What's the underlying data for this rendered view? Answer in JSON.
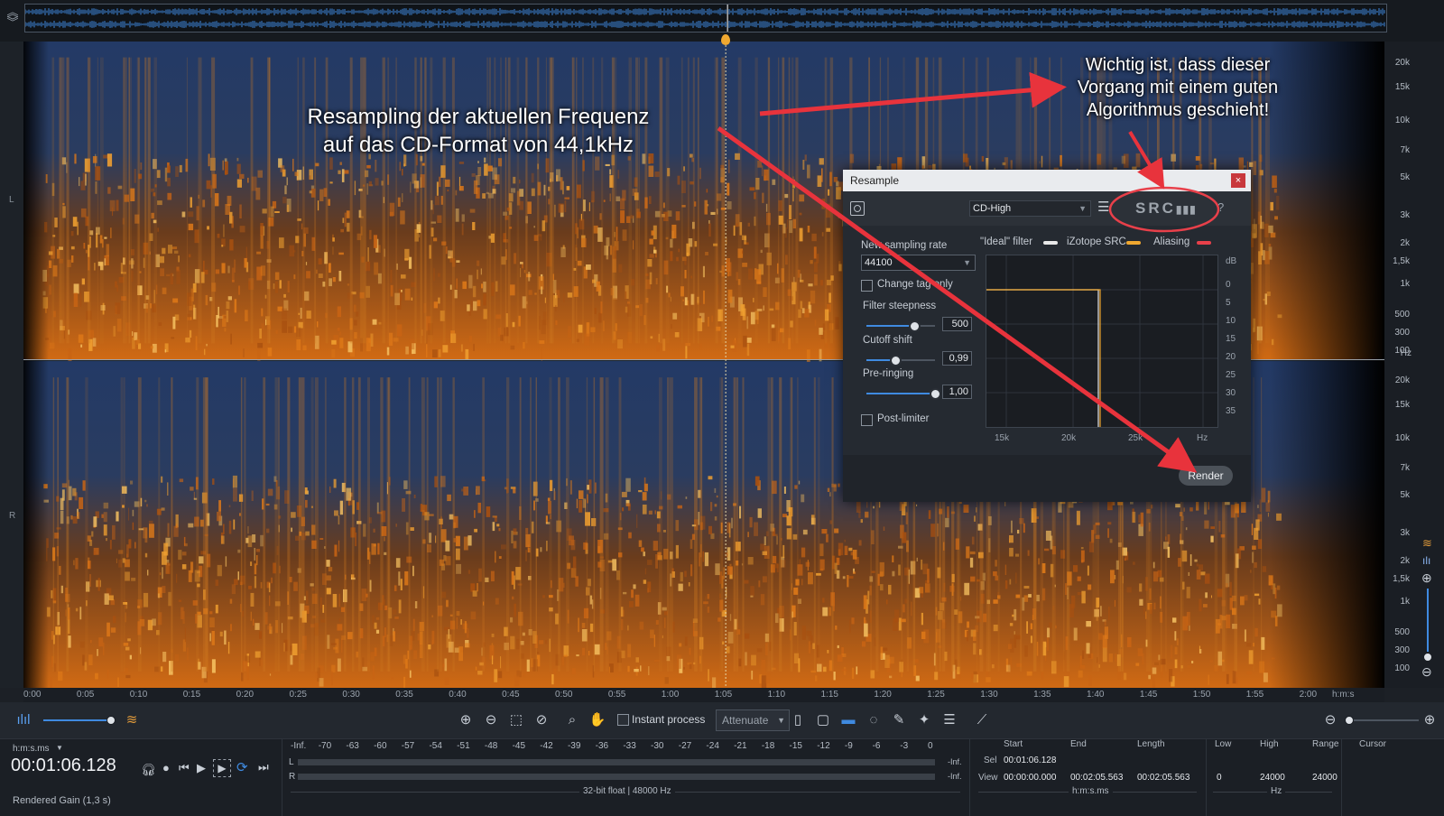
{
  "annotations": {
    "main_line1": "Resampling der aktuellen Frequenz",
    "main_line2": "auf das CD-Format von 44,1kHz",
    "note_line1": "Wichtig ist, dass dieser",
    "note_line2": "Vorgang mit einem guten",
    "note_line3": "Algorithmus geschieht!"
  },
  "channels": {
    "left": "L",
    "right": "R"
  },
  "freq_ticks": [
    "20k",
    "15k",
    "10k",
    "7k",
    "5k",
    "3k",
    "2k",
    "1,5k",
    "1k",
    "500",
    "300",
    "100",
    "Hz"
  ],
  "time_ticks": [
    "0:00",
    "0:05",
    "0:10",
    "0:15",
    "0:20",
    "0:25",
    "0:30",
    "0:35",
    "0:40",
    "0:45",
    "0:50",
    "0:55",
    "1:00",
    "1:05",
    "1:10",
    "1:15",
    "1:20",
    "1:25",
    "1:30",
    "1:35",
    "1:40",
    "1:45",
    "1:50",
    "1:55",
    "2:00",
    "h:m:s"
  ],
  "playhead_fraction": 0.516,
  "toolbar": {
    "instant_process": "Instant process",
    "attenuate": "Attenuate"
  },
  "dialog": {
    "title": "Resample",
    "close": "×",
    "preset": "CD-High",
    "logo": "SRC",
    "help": "?",
    "legend_ideal": "\"Ideal\" filter",
    "legend_izotope": "iZotope SRC",
    "legend_aliasing": "Aliasing",
    "legend_colors": {
      "ideal": "#e8e8e8",
      "izotope": "#f0a830",
      "aliasing": "#e8404a"
    },
    "sampling_rate_label": "New sampling rate",
    "sampling_rate_value": "44100",
    "change_tag_label": "Change tag only",
    "filter_steepness_label": "Filter steepness",
    "filter_steepness_value": "500",
    "filter_steepness_fraction": 0.7,
    "cutoff_label": "Cutoff shift",
    "cutoff_value": "0,99",
    "cutoff_fraction": 0.42,
    "preringing_label": "Pre-ringing",
    "preringing_value": "1,00",
    "preringing_fraction": 1.0,
    "post_limiter_label": "Post-limiter",
    "render": "Render",
    "graph_y": [
      "dB",
      "0",
      "5",
      "10",
      "15",
      "20",
      "25",
      "30",
      "35"
    ],
    "graph_x": [
      "15k",
      "20k",
      "25k",
      "Hz"
    ]
  },
  "status": {
    "time_format": "h:m:s.ms",
    "time": "00:01:06.128",
    "rendered_gain": "Rendered Gain (1,3 s)",
    "meter_scale": [
      "-Inf.",
      "-70",
      "-63",
      "-60",
      "-57",
      "-54",
      "-51",
      "-48",
      "-45",
      "-42",
      "-39",
      "-36",
      "-33",
      "-30",
      "-27",
      "-24",
      "-21",
      "-18",
      "-15",
      "-12",
      "-9",
      "-6",
      "-3",
      "0"
    ],
    "meter_l": "L",
    "meter_r": "R",
    "meter_l_val": "-Inf.",
    "meter_r_val": "-Inf.",
    "format": "32-bit float | 48000 Hz",
    "hdr_start": "Start",
    "hdr_end": "End",
    "hdr_length": "Length",
    "hdr_low": "Low",
    "hdr_high": "High",
    "hdr_range": "Range",
    "hdr_cursor": "Cursor",
    "sel_label": "Sel",
    "sel_start": "00:01:06.128",
    "view_label": "View",
    "view_start": "00:00:00.000",
    "view_end": "00:02:05.563",
    "view_length": "00:02:05.563",
    "low": "0",
    "high": "24000",
    "range": "24000",
    "unit_time": "h:m:s.ms",
    "unit_hz": "Hz"
  }
}
